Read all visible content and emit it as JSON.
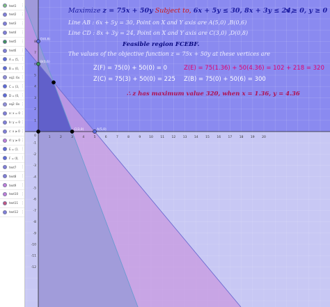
{
  "algebra": {
    "items": [
      {
        "label": "text1",
        "color": "#7fbf7f"
      },
      {
        "label": "text2",
        "color": "#7f7fd8"
      },
      {
        "label": "text3",
        "color": "#7f7fd8"
      },
      {
        "label": "text4",
        "color": "#7f7fd8"
      },
      {
        "label": "text5",
        "color": "#3d8f5a"
      },
      {
        "label": "text6",
        "color": "#7f7fd8"
      },
      {
        "label": "A = (5,",
        "color": "#5b6bd8"
      },
      {
        "label": "B = (0,",
        "color": "#5b6bd8"
      },
      {
        "label": "eq1: 6x",
        "color": "#8f8fd8"
      },
      {
        "label": "C = (3,",
        "color": "#5b6bd8"
      },
      {
        "label": "D = (0,",
        "color": "#5b6bd8"
      },
      {
        "label": "eq2: 8x",
        "color": "#8f8fd8"
      },
      {
        "label": "a: x = 0",
        "color": "#7f7fd8"
      },
      {
        "label": "b: y = 0",
        "color": "#7f7fd8"
      },
      {
        "label": "c: x ≥ 0",
        "color": "#7f7fd8"
      },
      {
        "label": "d: y ≥ 0",
        "color": "#c37fd8"
      },
      {
        "label": "E = (1.",
        "color": "#5b6bd8"
      },
      {
        "label": "F = (0,",
        "color": "#5b6bd8"
      },
      {
        "label": "text7",
        "color": "#7f7fd8"
      },
      {
        "label": "text8",
        "color": "#7f7fd8"
      },
      {
        "label": "text9",
        "color": "#c37fd8"
      },
      {
        "label": "text10",
        "color": "#c37fd8"
      },
      {
        "label": "text11",
        "color": "#c3577f"
      },
      {
        "label": "text12",
        "color": "#7f7fd8"
      }
    ]
  },
  "graph": {
    "x_range": [
      -1,
      20
    ],
    "y_range": [
      -12,
      9
    ],
    "x_ticks": [
      "1",
      "2",
      "3",
      "4",
      "5",
      "6",
      "7",
      "8",
      "9",
      "10",
      "11",
      "12",
      "13",
      "14",
      "15",
      "16",
      "17",
      "18",
      "19",
      "20"
    ],
    "y_ticks": [
      "1",
      "2",
      "3",
      "4",
      "5",
      "6",
      "7",
      "8",
      "-1",
      "-2",
      "-3",
      "-4",
      "-5",
      "-6",
      "-7",
      "-8",
      "-9",
      "-10",
      "-11",
      "-12"
    ],
    "origin_label": "0",
    "colors": {
      "upper_background": "#8a8af0",
      "lower_background": "#c8c8f4",
      "region_cd": "#9a9ad8",
      "region_ab": "#c89ae0",
      "feasible": "#5a5ac8",
      "line_ab": "#6a6ad0",
      "line_cd": "#6a9ad0",
      "vertex": "#000000"
    },
    "vertices": [
      {
        "name": "A",
        "label": "A(5,0)",
        "x": 5,
        "y": 0,
        "color": "#5b6bd8"
      },
      {
        "name": "B",
        "label": "B(0,6)",
        "x": 0,
        "y": 6,
        "color": "#3d8f5a"
      },
      {
        "name": "C",
        "label": "C(3,0)",
        "x": 3,
        "y": 0,
        "color": "#000000"
      },
      {
        "name": "D",
        "label": "D(0,8)",
        "x": 0,
        "y": 8,
        "color": "#5b6bd8"
      },
      {
        "name": "E",
        "label": "E",
        "x": 1.36,
        "y": 4.36,
        "color": "#000000"
      },
      {
        "name": "F",
        "label": "F",
        "x": 0,
        "y": 0,
        "color": "#000000"
      }
    ]
  },
  "text": {
    "maximize_word": "Maximize",
    "objective": "z = 75x + 50y",
    "subject_to": "Subject to,",
    "constraints": "6x + 5y ≤ 30,  8x + 3y ≤ 24,",
    "nonneg": "x ≥ 0,  y ≥ 0",
    "line_ab": "Line AB : 6x + 5y = 30,  Point on X and Y axis are A(5,0) ,B(0,6)",
    "line_cd": "Line CD : 8x + 3y = 24,  Point on X and Y axis are C(3,0) ,D(0,8)",
    "feasible": "Feasible region FCEBF.",
    "vertices_intro": "The values of the objective function z = 75x + 50y at these vertices are",
    "z_f": "Z(F) = 75(0) + 50(0) = 0",
    "z_e": "Z(E) = 75(1.36) + 50(4.36) = 102 + 218 = 320",
    "z_c": "Z(C) = 75(3) + 50(0) = 225",
    "z_b": "Z(B) = 75(0) + 50(6) = 300",
    "result": "∴ z has maximum value 320,  when x = 1.36,  y = 4.36"
  }
}
